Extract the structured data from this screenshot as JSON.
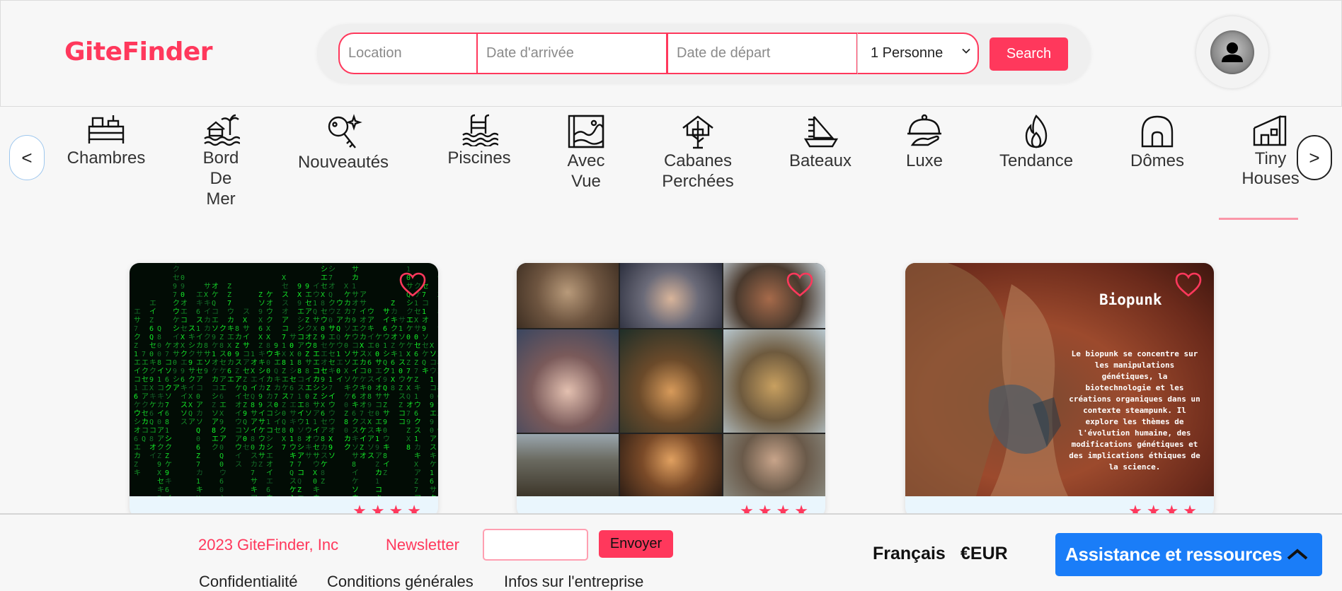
{
  "header": {
    "logo": "GiteFinder",
    "search": {
      "location_placeholder": "Location",
      "arrival_placeholder": "Date d'arrivée",
      "departure_placeholder": "Date de départ",
      "guests_value": "1 Personne",
      "search_label": "Search"
    },
    "avatar_icon": "user-avatar-icon"
  },
  "categories": {
    "prev_label": "<",
    "next_label": ">",
    "items": [
      {
        "label": "Chambres",
        "icon": "bed-icon"
      },
      {
        "label": "Bord De Mer",
        "icon": "beach-house-icon"
      },
      {
        "label": "Nouveautés",
        "icon": "key-sparkle-icon"
      },
      {
        "label": "Piscines",
        "icon": "pool-icon"
      },
      {
        "label": "Avec Vue",
        "icon": "landscape-view-icon"
      },
      {
        "label": "Cabanes Perchées",
        "icon": "treehouse-icon"
      },
      {
        "label": "Bateaux",
        "icon": "sailboat-icon"
      },
      {
        "label": "Luxe",
        "icon": "cloche-icon"
      },
      {
        "label": "Tendance",
        "icon": "flame-icon"
      },
      {
        "label": "Dômes",
        "icon": "dome-icon"
      },
      {
        "label": "Tiny Houses",
        "icon": "tiny-house-icon"
      }
    ],
    "selected_index": 10
  },
  "listings": [
    {
      "image": "matrix-code-image",
      "favorite_icon": "heart-icon"
    },
    {
      "image": "steampunk-portraits-image",
      "favorite_icon": "heart-icon"
    },
    {
      "image": "biopunk-image",
      "favorite_icon": "heart-icon",
      "image_title": "Biopunk",
      "image_text": "Le biopunk se concentre sur les manipulations génétiques, la biotechnologie et les créations organiques dans un contexte steampunk. Il explore les thèmes de l'évolution humaine, des modifications génétiques et des implications éthiques de la science."
    }
  ],
  "footer": {
    "copyright": "2023 GiteFinder, Inc",
    "newsletter_label": "Newsletter",
    "send_label": "Envoyer",
    "links": [
      "Confidentialité",
      "Conditions générales",
      "Infos sur l'entreprise"
    ],
    "language": "Français",
    "currency": "€EUR",
    "assistance_label": "Assistance et ressources"
  },
  "colors": {
    "brand": "#ff385c",
    "assist_button": "#1a7df8"
  }
}
